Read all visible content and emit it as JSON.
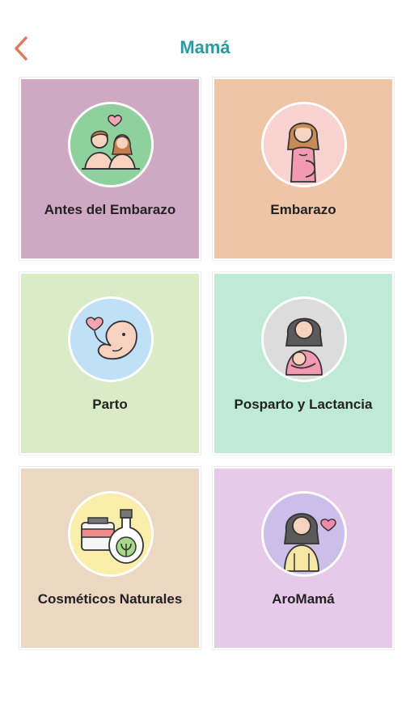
{
  "header": {
    "title": "Mamá",
    "back_icon": "chevron-left-icon",
    "accent_color": "#2a9aa0",
    "back_color": "#e07a5f"
  },
  "categories": [
    {
      "label": "Antes del Embarazo",
      "icon": "couple-heart-icon",
      "bg": "#cfa9c4",
      "circle": "#8fd19e"
    },
    {
      "label": "Embarazo",
      "icon": "pregnant-woman-icon",
      "bg": "#eec5a6",
      "circle": "#f9d3d0"
    },
    {
      "label": "Parto",
      "icon": "baby-fetus-icon",
      "bg": "#d9ebc7",
      "circle": "#bfe0f6"
    },
    {
      "label": "Posparto y Lactancia",
      "icon": "breastfeeding-icon",
      "bg": "#bfead7",
      "circle": "#dcdcdc"
    },
    {
      "label": "Cosméticos Naturales",
      "icon": "natural-cosmetics-icon",
      "bg": "#ecd7c3",
      "circle": "#fbeeaa"
    },
    {
      "label": "AroMamá",
      "icon": "woman-heart-icon",
      "bg": "#e7c9e9",
      "circle": "#cdbde9"
    }
  ]
}
